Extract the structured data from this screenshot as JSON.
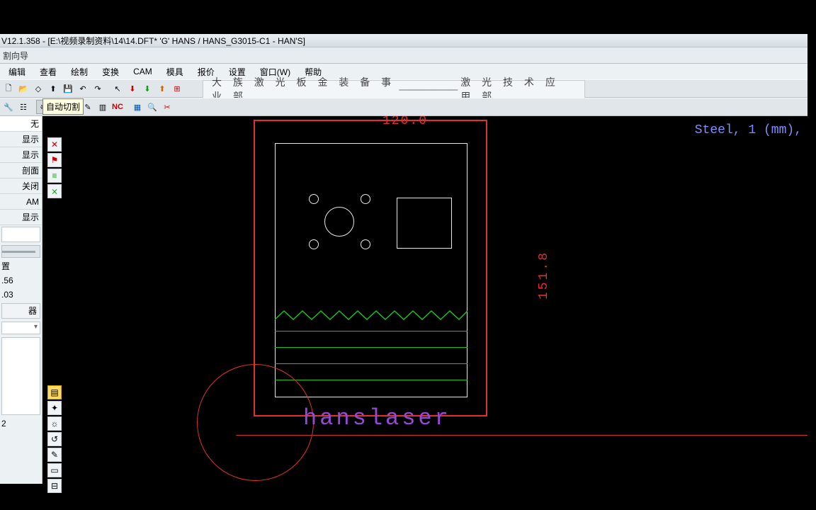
{
  "title_bar": "V12.1.358 - [E:\\视频录制资料\\14\\14.DFT*  'G' HANS / HANS_G3015-C1         - HAN'S]",
  "sub_bar": "割向导",
  "menu": {
    "m1": "编辑",
    "m2": "查看",
    "m3": "绘制",
    "m4": "变换",
    "m5": "CAM",
    "m6": "模具",
    "m7": "报价",
    "m8": "设置",
    "m9": "窗口(W)",
    "m10": "帮助"
  },
  "banner": {
    "left": "大 族 激 光 板 金 装 备 事 业 部",
    "right": "激 光 技 术 应 用 部"
  },
  "tooltip": "自动切割",
  "side": {
    "s0": "无",
    "s1": "显示",
    "s2": "显示",
    "s3": "剖面",
    "s4": "关闭",
    "s5": "AM",
    "s6": "显示",
    "p1": "置",
    "n1": ".56",
    "n2": ".03",
    "b1": "器",
    "n3": "2"
  },
  "canvas": {
    "dim_top": "120.0",
    "dim_right": "151.8",
    "material": "Steel, 1 (mm),",
    "brand": "hanslaser"
  },
  "nc_label": "NC"
}
